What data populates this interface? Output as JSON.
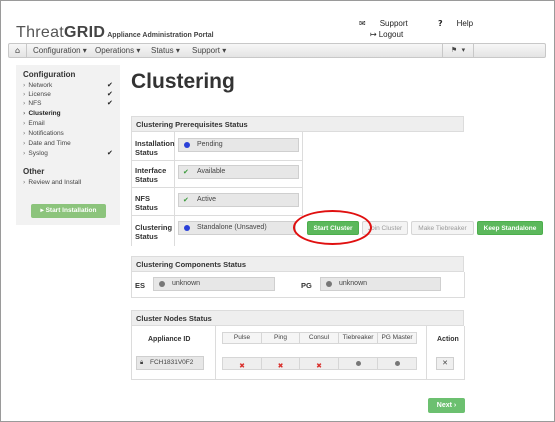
{
  "header": {
    "logo_threat": "Threat",
    "logo_grid": "GRID",
    "logo_subtitle": "Appliance Administration Portal",
    "support_label": "Support",
    "help_label": "Help",
    "logout_label": "Logout"
  },
  "navbar": {
    "home_icon": "home-icon",
    "items": [
      {
        "label": "Configuration ▾"
      },
      {
        "label": "Operations ▾"
      },
      {
        "label": "Status ▾"
      },
      {
        "label": "Support ▾"
      }
    ],
    "flag_icon": "flag-icon"
  },
  "sidebar": {
    "configuration_heading": "Configuration",
    "items": [
      {
        "label": "Network",
        "checked": true
      },
      {
        "label": "License",
        "checked": true
      },
      {
        "label": "NFS",
        "checked": true
      },
      {
        "label": "Clustering",
        "checked": false,
        "active": true
      },
      {
        "label": "Email",
        "checked": false
      },
      {
        "label": "Notifications",
        "checked": false
      },
      {
        "label": "Date and Time",
        "checked": false
      },
      {
        "label": "Syslog",
        "checked": true
      }
    ],
    "other_heading": "Other",
    "other_items": [
      {
        "label": "Review and Install"
      }
    ],
    "start_installation_label": "▸ Start Installation"
  },
  "main": {
    "title": "Clustering",
    "prereq": {
      "heading": "Clustering Prerequisites Status",
      "installation_label_1": "Installation",
      "installation_label_2": "Status",
      "installation_value": "Pending",
      "interface_label_1": "Interface",
      "interface_label_2": "Status",
      "interface_value": "Available",
      "nfs_label_1": "NFS",
      "nfs_label_2": "Status",
      "nfs_value": "Active",
      "clustering_label_1": "Clustering",
      "clustering_label_2": "Status",
      "clustering_value": "Standalone (Unsaved)",
      "start_cluster": "Start Cluster",
      "join_cluster": "Join Cluster",
      "make_tiebreaker": "Make Tiebreaker",
      "keep_standalone": "Keep Standalone"
    },
    "components": {
      "heading": "Clustering Components Status",
      "es_label": "ES",
      "es_value": "unknown",
      "pg_label": "PG",
      "pg_value": "unknown"
    },
    "nodes": {
      "heading": "Cluster Nodes Status",
      "appliance_id_header": "Appliance ID",
      "columns": [
        "Pulse",
        "Ping",
        "Consul",
        "Tiebreaker",
        "PG Master"
      ],
      "action_header": "Action",
      "row": {
        "appliance_id": "FCH1831V0F2",
        "statuses": [
          "x",
          "x",
          "x",
          "dot",
          "dot"
        ]
      }
    },
    "next_label": "Next ›"
  },
  "colors": {
    "green_button": "#5cb85c",
    "sidebar_button": "#8cc47c",
    "pending_dot": "#2a40d8",
    "red_highlight": "#e01010"
  }
}
